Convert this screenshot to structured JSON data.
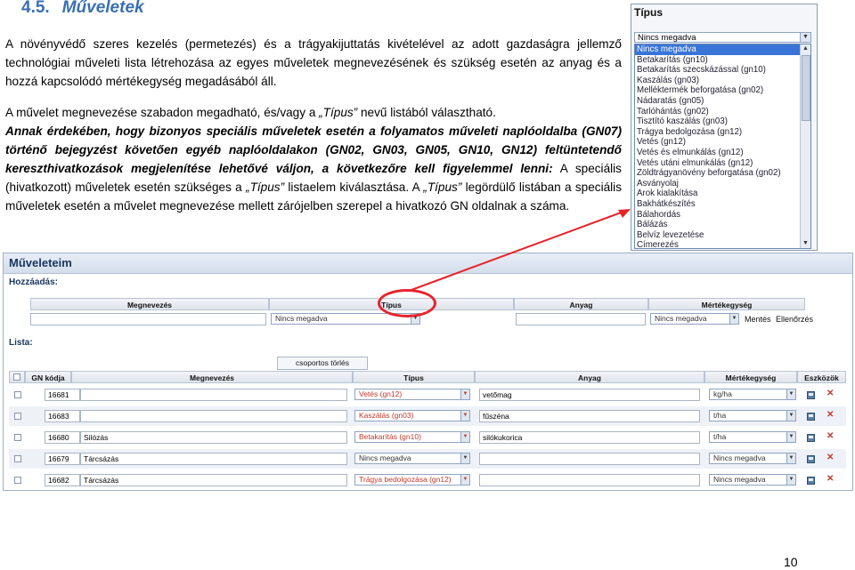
{
  "section": {
    "number": "4.5.",
    "title": "Műveletek"
  },
  "paragraphs": {
    "p1": "A növényvédő szeres kezelés (permetezés) és a trágyakijuttatás kivételével az adott gazdaságra jellemző technológiai műveleti lista létrehozása az egyes műveletek megnevezésének és szükség esetén az anyag és a hozzá kapcsolódó mértékegység megadásából áll.",
    "p2_a": "A művelet megnevezése szabadon megadható, és/vagy a ",
    "p2_italic": "„Típus”",
    "p2_b": " nevű listából választható.",
    "p3_bold": "Annak érdekében, hogy bizonyos speciális műveletek esetén a folyamatos műveleti naplóoldalba (GN07) történő bejegyzést követően egyéb naplóoldalakon (GN02, GN03, GN05, GN10, GN12) feltüntetendő kereszthivatkozások megjelenítése lehetővé váljon, a következőre kell figyelemmel lenni:",
    "p3_a": " A speciális (hivatkozott) műveletek esetén szükséges a ",
    "p3_italic1": "„Típus”",
    "p3_b": " listaelem kiválasztása. A ",
    "p3_italic2": "„Típus”",
    "p3_c": " legördülő listában a speciális műveletek esetén a művelet megnevezése mellett zárójelben szerepel a hivatkozó GN oldalnak a száma."
  },
  "dropdown": {
    "title": "Típus",
    "selected": "Nincs megadva",
    "options": [
      "Nincs megadva",
      "Betakarítás (gn10)",
      "Betakarítás szecskázással (gn10)",
      "Kaszálás (gn03)",
      "Melléktermék beforgatása (gn02)",
      "Nádaratás (gn05)",
      "Tarlóhántás (gn02)",
      "Tisztító kaszálás (gn03)",
      "Trágya bedolgozása (gn12)",
      "Vetés (gn12)",
      "Vetés és elmunkálás (gn12)",
      "Vetés utáni elmunkálás (gn12)",
      "Zöldtrágyanövény beforgatása (gn02)",
      "Ásványolaj",
      "Árok kialakítása",
      "Bakhátkészítés",
      "Bálahordás",
      "Bálázás",
      "Belvíz levezetése",
      "Címerezés"
    ]
  },
  "form": {
    "title": "Műveleteim",
    "add_label": "Hozzáadás:",
    "list_label": "Lista:",
    "headers": {
      "name": "Megnevezés",
      "type": "Típus",
      "material": "Anyag",
      "unit": "Mértékegység"
    },
    "add_row": {
      "type": "Nincs megadva",
      "material": "",
      "unit": "Nincs megadva",
      "save": "Mentés",
      "check": "Ellenőrzés"
    },
    "group_button": "csoportos törlés",
    "list_headers": {
      "id": "GN kódja",
      "name": "Megnevezés",
      "type": "Típus",
      "material": "Anyag",
      "unit": "Mértékegység",
      "tools": "Eszközök"
    },
    "rows": [
      {
        "id": "16681",
        "name": "",
        "type": "Vetés (gn12)",
        "material": "vetőmag",
        "unit": "kg/ha"
      },
      {
        "id": "16683",
        "name": "",
        "type": "Kaszálás (gn03)",
        "material": "fűszéna",
        "unit": "t/ha"
      },
      {
        "id": "16680",
        "name": "Silózás",
        "type": "Betakarítás (gn10)",
        "material": "silókukorica",
        "unit": "t/ha"
      },
      {
        "id": "16679",
        "name": "Tárcsázás",
        "type": "Nincs megadva",
        "material": "",
        "unit": "Nincs megadva"
      },
      {
        "id": "16682",
        "name": "Tárcsázás",
        "type": "Trágya bedolgozása (gn12)",
        "material": "",
        "unit": "Nincs megadva"
      }
    ]
  },
  "page_number": "10",
  "colors": {
    "heading": "#3a6fb0",
    "highlight": "#e8222b",
    "selected": "#3875d7"
  }
}
